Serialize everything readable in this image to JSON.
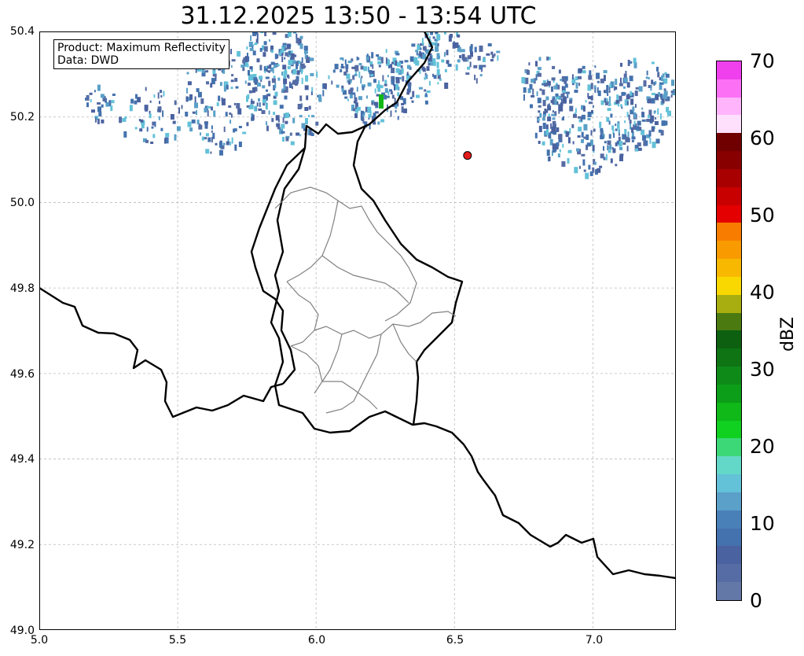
{
  "title": "31.12.2025 13:50 - 13:54 UTC",
  "info_box": {
    "line1": "Product: Maximum Reflectivity",
    "line2": "Data: DWD"
  },
  "map": {
    "lon_range": [
      5.0,
      7.3
    ],
    "lat_range": [
      49.0,
      50.4
    ],
    "x_ticks": [
      "5.0",
      "5.5",
      "6.0",
      "6.5",
      "7.0"
    ],
    "y_ticks": [
      "50.4",
      "50.2",
      "50.0",
      "49.8",
      "49.6",
      "49.4",
      "49.2",
      "49.0"
    ],
    "grid": true,
    "marker": {
      "lon": 6.547,
      "lat": 50.11,
      "color": "#e31a1c"
    },
    "border_color": "#000000",
    "district_color": "#808080"
  },
  "colorbar": {
    "label": "dBZ",
    "ticks": [
      "70",
      "60",
      "50",
      "40",
      "30",
      "20",
      "10",
      "0"
    ],
    "range": [
      0,
      70
    ],
    "colors": [
      "#6478a8",
      "#566ca4",
      "#4a62a0",
      "#4472ae",
      "#4a80b8",
      "#5aa0c8",
      "#63c1d8",
      "#64d8c8",
      "#3cd878",
      "#10d020",
      "#10b818",
      "#0c9e18",
      "#0e8a18",
      "#0e7414",
      "#0c6010",
      "#4a7a10",
      "#a8ae10",
      "#f8d800",
      "#f8b800",
      "#f89a00",
      "#f87c00",
      "#e40000",
      "#c80000",
      "#a80000",
      "#880000",
      "#700000",
      "#fee0fc",
      "#ffb4fc",
      "#fc70f6",
      "#f040ee"
    ]
  }
}
